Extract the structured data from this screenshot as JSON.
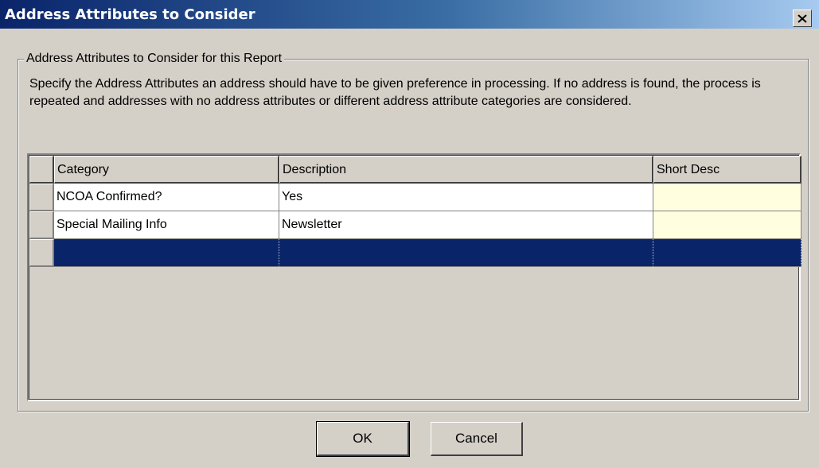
{
  "window": {
    "title": "Address Attributes to Consider"
  },
  "group": {
    "label": "Address Attributes to Consider for this Report",
    "instructions": "Specify the Address Attributes an address should have to be given preference in processing.  If no address is found, the process is repeated and addresses with no address attributes or different address attribute categories are considered."
  },
  "grid": {
    "columns": [
      "Category",
      "Description",
      "Short Desc"
    ],
    "rows": [
      {
        "category": "NCOA Confirmed?",
        "description": "Yes",
        "short_desc": ""
      },
      {
        "category": "Special Mailing Info",
        "description": "Newsletter",
        "short_desc": ""
      },
      {
        "category": "",
        "description": "",
        "short_desc": "",
        "selected": true
      }
    ]
  },
  "buttons": {
    "ok": "OK",
    "cancel": "Cancel"
  },
  "colors": {
    "title_gradient_start": "#0a246a",
    "selection": "#0a246a",
    "short_desc_cell": "#ffffe0",
    "dialog_face": "#d4d0c8"
  },
  "icons": {
    "close": "close-icon"
  }
}
